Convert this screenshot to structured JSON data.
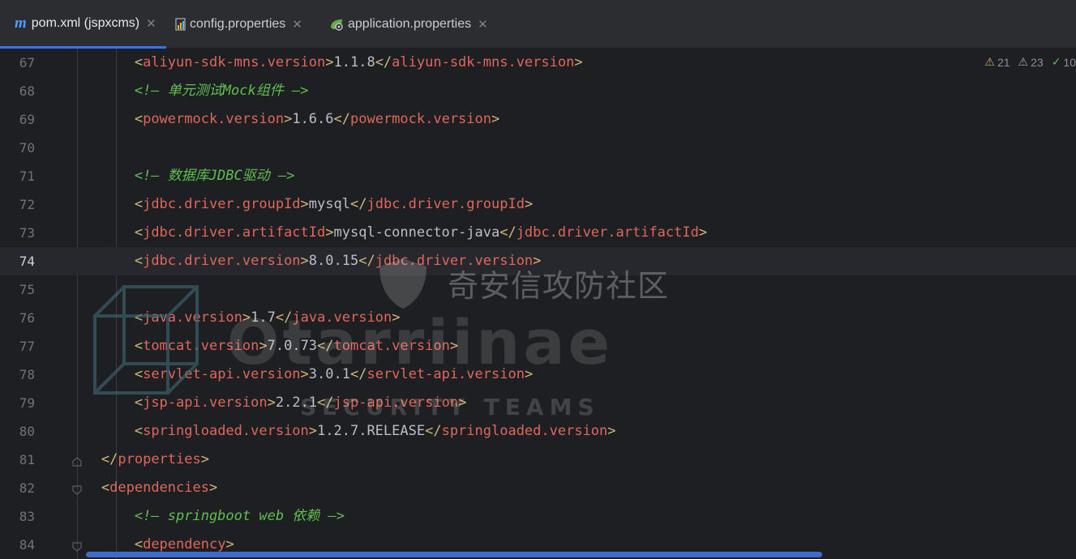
{
  "tabs": [
    {
      "icon": "maven-icon",
      "label": "pom.xml (jspxcms)",
      "active": true
    },
    {
      "icon": "properties-file-icon",
      "label": "config.properties",
      "active": false
    },
    {
      "icon": "spring-properties-icon",
      "label": "application.properties",
      "active": false
    }
  ],
  "inspections": {
    "warnings": "21",
    "weak_warnings": "23",
    "ok": "10"
  },
  "current_line": "74",
  "lines": [
    {
      "n": "67",
      "indent": "            ",
      "open": "aliyun-sdk-mns.version",
      "val": "1.1.8",
      "close": "aliyun-sdk-mns.version"
    },
    {
      "n": "68",
      "indent": "            ",
      "comment": "<!-- 单元测试Mock组件 -->"
    },
    {
      "n": "69",
      "indent": "            ",
      "open": "powermock.version",
      "val": "1.6.6",
      "close": "powermock.version"
    },
    {
      "n": "70",
      "indent": ""
    },
    {
      "n": "71",
      "indent": "            ",
      "comment": "<!-- 数据库JDBC驱动 -->"
    },
    {
      "n": "72",
      "indent": "            ",
      "open": "jdbc.driver.groupId",
      "val": "mysql",
      "close": "jdbc.driver.groupId"
    },
    {
      "n": "73",
      "indent": "            ",
      "open": "jdbc.driver.artifactId",
      "val": "mysql-connector-java",
      "close": "jdbc.driver.artifactId"
    },
    {
      "n": "74",
      "indent": "            ",
      "open": "jdbc.driver.version",
      "val": "8.0.15",
      "close": "jdbc.driver.version"
    },
    {
      "n": "75",
      "indent": ""
    },
    {
      "n": "76",
      "indent": "            ",
      "open": "java.version",
      "val": "1.7",
      "close": "java.version"
    },
    {
      "n": "77",
      "indent": "            ",
      "open": "tomcat.version",
      "val": "7.0.73",
      "close": "tomcat.version"
    },
    {
      "n": "78",
      "indent": "            ",
      "open": "servlet-api.version",
      "val": "3.0.1",
      "close": "servlet-api.version"
    },
    {
      "n": "79",
      "indent": "            ",
      "open": "jsp-api.version",
      "val": "2.2.1",
      "close": "jsp-api.version"
    },
    {
      "n": "80",
      "indent": "            ",
      "open": "springloaded.version",
      "val": "1.2.7.RELEASE",
      "close": "springloaded.version"
    },
    {
      "n": "81",
      "indent": "        ",
      "close_only": "properties"
    },
    {
      "n": "82",
      "indent": "        ",
      "open_only": "dependencies"
    },
    {
      "n": "83",
      "indent": "            ",
      "comment": "<!-- springboot web 依赖 -->"
    },
    {
      "n": "84",
      "indent": "            ",
      "open_only": "dependency"
    }
  ],
  "watermark": {
    "cn": "奇安信攻防社区",
    "brand": "Otarriinae",
    "sub": "SECURITY TEAMS"
  }
}
